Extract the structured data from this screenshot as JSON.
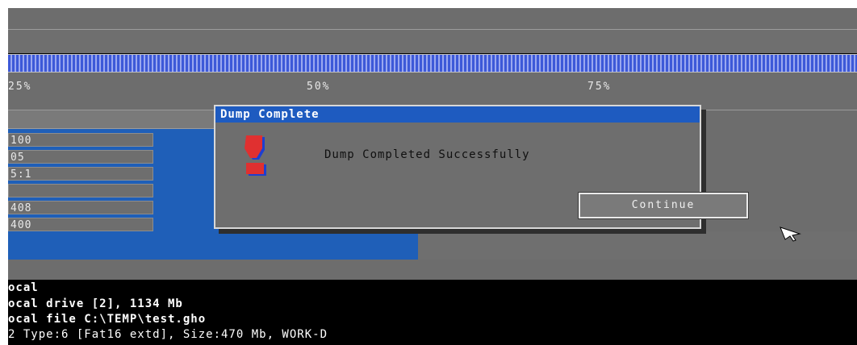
{
  "progress": {
    "percent": 100,
    "scale_labels": [
      "25%",
      "50%",
      "75%"
    ]
  },
  "stats": {
    "fields": [
      "100",
      "05",
      "5:1",
      "",
      "408",
      "400"
    ]
  },
  "dialog": {
    "title": "Dump Complete",
    "message": "Dump Completed Successfully",
    "continue_label": "Continue"
  },
  "console": {
    "lines": [
      "ocal",
      "ocal drive [2], 1134 Mb",
      "ocal file C:\\TEMP\\test.gho",
      "2 Type:6 [Fat16 extd], Size:470 Mb, WORK-D"
    ]
  },
  "colors": {
    "screen_gray": "#6d6d6d",
    "panel_blue": "#1f5fb8",
    "title_blue": "#1e5bc0",
    "progress_blue": "#3d59d8"
  },
  "icons": {
    "dialog_icon": "exclamation-icon",
    "cursor_icon": "mouse-pointer-icon"
  }
}
